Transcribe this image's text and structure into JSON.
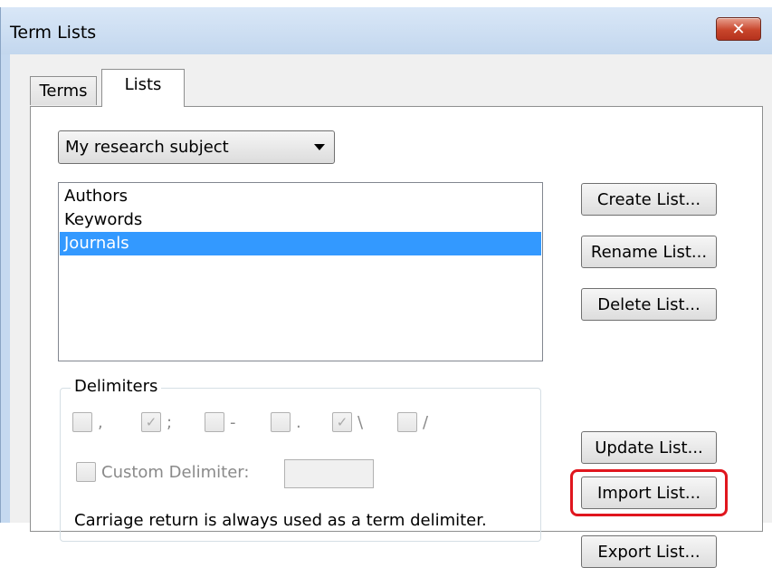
{
  "window": {
    "title": "Term Lists",
    "close_label": "✕"
  },
  "tabs": [
    {
      "label": "Terms",
      "active": false
    },
    {
      "label": "Lists",
      "active": true
    }
  ],
  "list_selector": {
    "selected": "My research subject"
  },
  "lists": {
    "items": [
      {
        "label": "Authors",
        "selected": false
      },
      {
        "label": "Keywords",
        "selected": false
      },
      {
        "label": "Journals",
        "selected": true
      }
    ]
  },
  "buttons": {
    "create": "Create List...",
    "rename": "Rename List...",
    "delete": "Delete List...",
    "update": "Update List...",
    "import": "Import List...",
    "export": "Export List..."
  },
  "delimiters": {
    "legend": "Delimiters",
    "options": [
      {
        "symbol": ",",
        "checked": false
      },
      {
        "symbol": ";",
        "checked": true
      },
      {
        "symbol": "-",
        "checked": false
      },
      {
        "symbol": ".",
        "checked": false
      },
      {
        "symbol": "\\",
        "checked": true
      },
      {
        "symbol": "/",
        "checked": false
      }
    ],
    "custom_label": "Custom Delimiter:",
    "custom_value": "",
    "note": "Carriage return is always used as a term delimiter."
  },
  "colors": {
    "selection": "#3399ff",
    "highlight": "#e0161e",
    "close_button": "#c8452b"
  }
}
